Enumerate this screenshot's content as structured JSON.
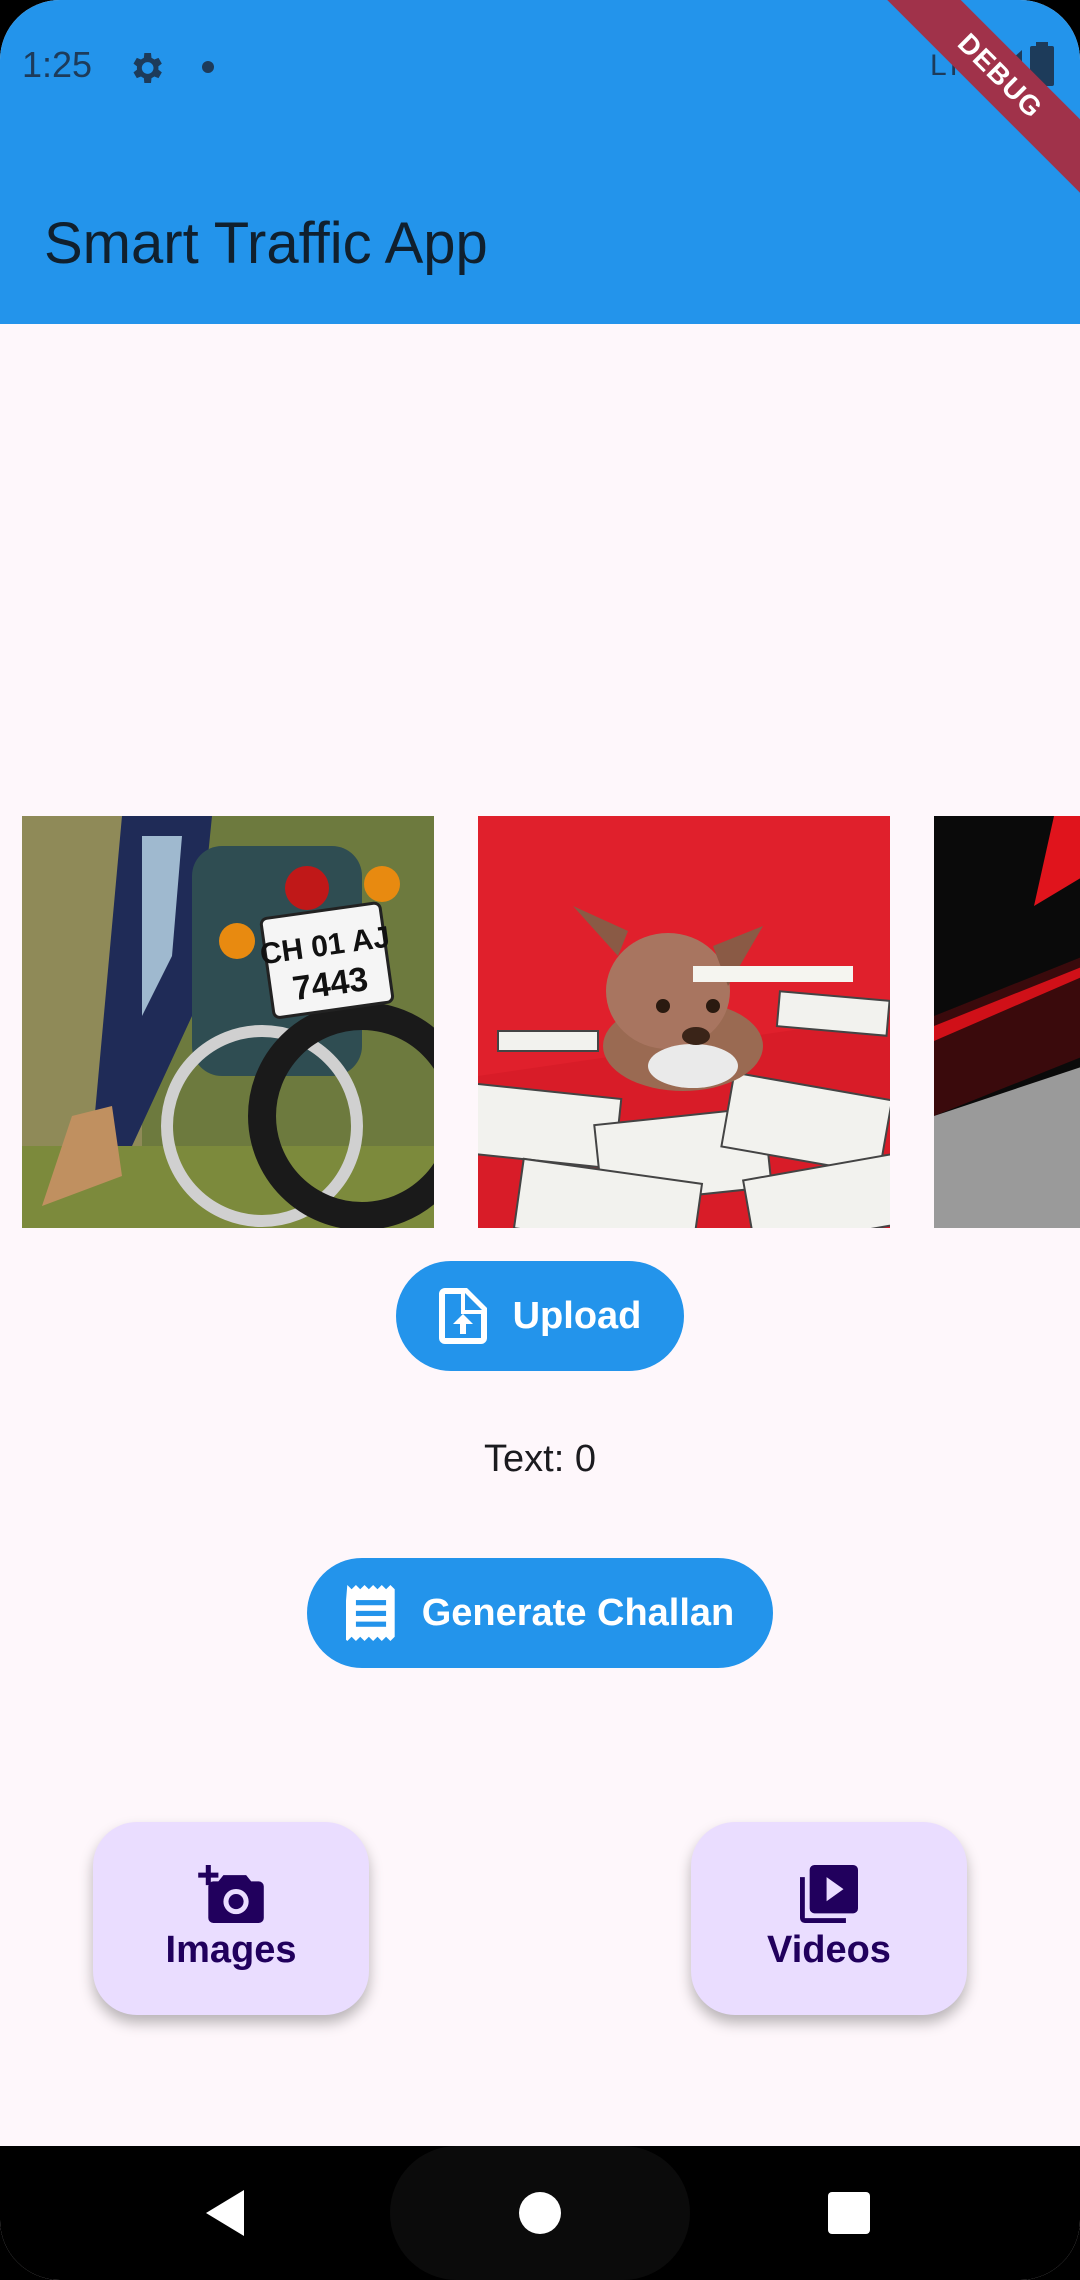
{
  "status_bar": {
    "time": "1:25",
    "network": "LTE",
    "icons": [
      "gear-icon",
      "dot-icon",
      "signal-icon",
      "battery-icon"
    ]
  },
  "debug_banner": "DEBUG",
  "app_bar": {
    "title": "Smart Traffic App",
    "color": "#2394eb"
  },
  "carousel": {
    "images": [
      {
        "name": "motorcycle-plate-image",
        "plate_text": "CH 01 AJ 7443"
      },
      {
        "name": "dog-money-image"
      },
      {
        "name": "tunnel-image"
      }
    ]
  },
  "upload_button": {
    "label": "Upload",
    "icon": "upload-file-icon"
  },
  "result_text": "Text: 0",
  "challan_button": {
    "label": "Generate Challan",
    "icon": "receipt-icon"
  },
  "fabs": [
    {
      "label": "Images",
      "icon": "add-photo-icon"
    },
    {
      "label": "Videos",
      "icon": "video-library-icon"
    }
  ],
  "colors": {
    "accent": "#2394eb",
    "fab_bg": "#eaddff",
    "fab_fg": "#21005d",
    "background": "#fef7fb"
  }
}
